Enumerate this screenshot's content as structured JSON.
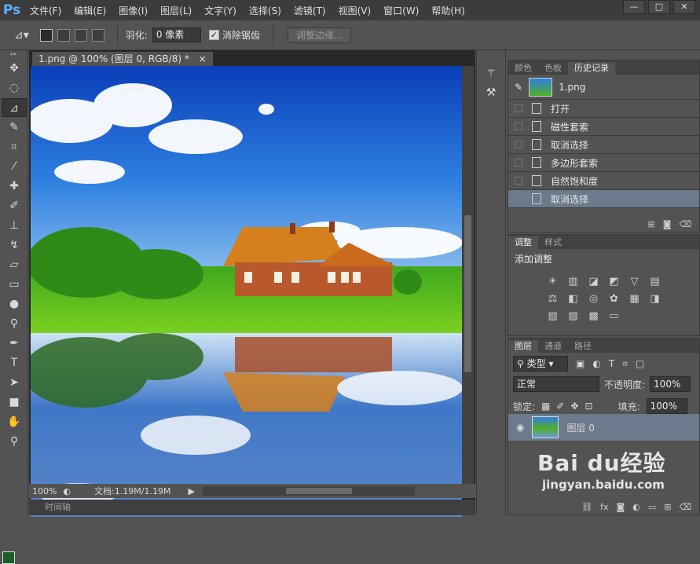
{
  "app": {
    "logo": "Ps"
  },
  "menu": [
    "文件(F)",
    "编辑(E)",
    "图像(I)",
    "图层(L)",
    "文字(Y)",
    "选择(S)",
    "滤镜(T)",
    "视图(V)",
    "窗口(W)",
    "帮助(H)"
  ],
  "window_buttons": [
    "—",
    "□",
    "✕"
  ],
  "options": {
    "feather_label": "羽化:",
    "feather_value": "0 像素",
    "antialias_label": "消除锯齿",
    "antialias_checked": true,
    "refine_edge": "调整边缘..."
  },
  "document": {
    "tab_title": "1.png @ 100% (图层 0, RGB/8) *",
    "close": "×",
    "zoom": "100%",
    "doc_info": "文档:1.19M/1.19M",
    "timeline_label": "时间轴"
  },
  "history_panel": {
    "tabs": [
      "颜色",
      "色板",
      "历史记录"
    ],
    "active_tab": 2,
    "snapshot": "1.png",
    "items": [
      "打开",
      "磁性套索",
      "取消选择",
      "多边形套索",
      "自然饱和度",
      "取消选择"
    ],
    "selected_index": 5
  },
  "adjustments_panel": {
    "tabs": [
      "调整",
      "样式"
    ],
    "active_tab": 0,
    "title": "添加调整",
    "icons": [
      "brightness-icon",
      "levels-icon",
      "curves-icon",
      "exposure-icon",
      "vibrance-icon",
      "hue-icon",
      "color-balance-icon",
      "bw-icon",
      "photo-filter-icon",
      "channel-mixer-icon",
      "color-lookup-icon",
      "invert-icon",
      "posterize-icon",
      "threshold-icon",
      "gradient-map-icon",
      "selective-color-icon"
    ]
  },
  "layers_panel": {
    "tabs": [
      "图层",
      "通道",
      "路径"
    ],
    "active_tab": 0,
    "filter_label": "类型",
    "blend_mode": "正常",
    "opacity_label": "不透明度:",
    "opacity_value": "100%",
    "lock_label": "锁定:",
    "fill_label": "填充:",
    "fill_value": "100%",
    "layer_name": "图层 0"
  },
  "watermark": {
    "text": "Bai du经验",
    "url": "jingyan.baidu.com"
  }
}
